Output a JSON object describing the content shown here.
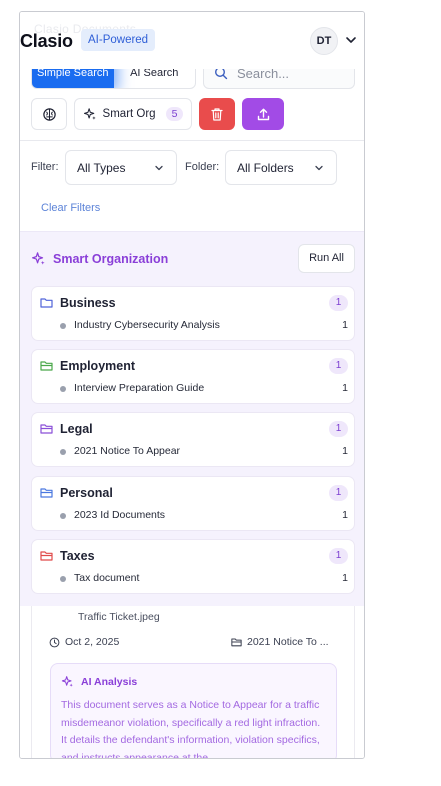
{
  "header": {
    "ghost_text": "Clasio Documents",
    "brand": "Clasio",
    "badge": "AI-Powered",
    "avatar": "DT"
  },
  "toolbar": {
    "tabs": [
      {
        "label": "Simple Search",
        "active": true
      },
      {
        "label": "AI Search",
        "active": false
      }
    ],
    "search_placeholder": "Search...",
    "smart_org_label": "Smart Org",
    "smart_org_count": "5"
  },
  "filters": {
    "filter_label": "Filter:",
    "filter_value": "All Types",
    "folder_label": "Folder:",
    "folder_value": "All Folders",
    "clear_label": "Clear Filters"
  },
  "smart_organization": {
    "title": "Smart Organization",
    "run_all_label": "Run All",
    "folders": [
      {
        "name": "Business",
        "count": "1",
        "doc": "Industry Cybersecurity Analysis",
        "doc_count": "1",
        "color": "#4f63d9"
      },
      {
        "name": "Employment",
        "count": "1",
        "doc": "Interview Preparation Guide",
        "doc_count": "1",
        "color": "#4aa84a"
      },
      {
        "name": "Legal",
        "count": "1",
        "doc": "2021 Notice To Appear",
        "doc_count": "1",
        "color": "#8a4fd8"
      },
      {
        "name": "Personal",
        "count": "1",
        "doc": "2023 Id Documents",
        "doc_count": "1",
        "color": "#4a78e0"
      },
      {
        "name": "Taxes",
        "count": "1",
        "doc": "Tax document",
        "doc_count": "1",
        "color": "#e04a4a"
      }
    ]
  },
  "document": {
    "filename": "Traffic Ticket.jpeg",
    "date": "Oct 2, 2025",
    "folder": "2021 Notice To ...",
    "ai_title": "AI Analysis",
    "ai_text": "This document serves as a Notice to Appear for a traffic misdemeanor violation, specifically a red light infraction. It details the defendant's information, violation specifics, and instructs appearance at the"
  },
  "colors": {
    "primary": "#1a6cf0",
    "danger": "#e94c4c",
    "accent_purple": "#a24be6",
    "panel_bg": "#f5f2fd"
  }
}
